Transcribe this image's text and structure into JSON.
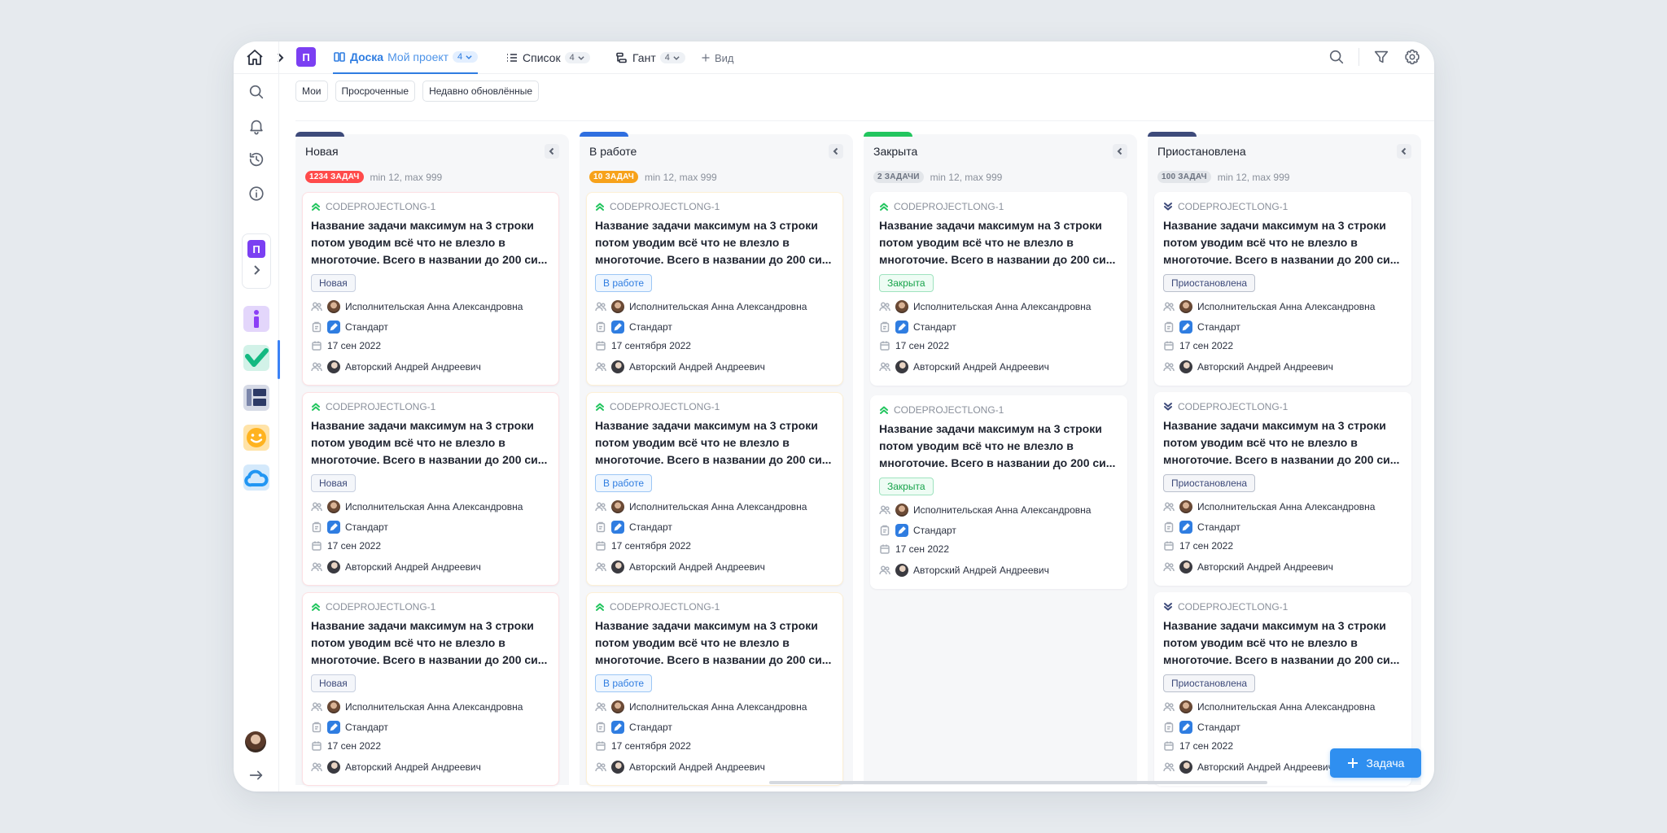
{
  "colors": {
    "accent": "#2f7de1",
    "project_badge": "#7b3ff2",
    "new_badge": "#ff4b4b",
    "in_progress_badge": "#f7a21b",
    "closed_accent": "#22c55e",
    "paused_accent": "#3d4a7a"
  },
  "topbar": {
    "project_letter": "П",
    "tabs": [
      {
        "name": "Доска",
        "project": "Мой проект",
        "count": "4",
        "icon": "board-icon"
      },
      {
        "name": "Список",
        "count": "4",
        "icon": "list-icon"
      },
      {
        "name": "Гант",
        "count": "4",
        "icon": "gantt-icon"
      }
    ],
    "add_view_label": "Вид"
  },
  "filters": [
    "Мои",
    "Просроченные",
    "Недавно обновлённые"
  ],
  "sidebar": {
    "project_letter": "П",
    "icons": [
      "home-icon",
      "search-icon",
      "bell-icon",
      "history-icon",
      "info-icon"
    ]
  },
  "columns": [
    {
      "title": "Новая",
      "badge": "1234 ЗАДАЧ",
      "badge_color": "#ff4b4b",
      "limits": "min 12, max 999",
      "accent": "#3d4a7a",
      "cards": [
        {
          "code": "CODEPROJECTLONG-1",
          "priority": "up",
          "title": "Название задачи максимум на 3 строки потом уводим всё что не влезло в многоточие. Всего в названии до 200 си...",
          "status": "Новая",
          "assignee": "Исполнительская Анна Александровна",
          "type": "Стандарт",
          "date": "17 сен 2022",
          "author": "Авторский Андрей Андреевич"
        },
        {
          "code": "CODEPROJECTLONG-1",
          "priority": "up",
          "title": "Название задачи максимум на 3 строки потом уводим всё что не влезло в многоточие. Всего в названии до 200 си...",
          "status": "Новая",
          "assignee": "Исполнительская Анна Александровна",
          "type": "Стандарт",
          "date": "17 сен 2022",
          "author": "Авторский Андрей Андреевич"
        },
        {
          "code": "CODEPROJECTLONG-1",
          "priority": "up",
          "title": "Название задачи максимум на 3 строки потом уводим всё что не влезло в многоточие. Всего в названии до 200 си...",
          "status": "Новая",
          "assignee": "Исполнительская Анна Александровна",
          "type": "Стандарт",
          "date": "17 сен 2022",
          "author": "Авторский Андрей Андреевич"
        }
      ]
    },
    {
      "title": "В работе",
      "badge": "10 ЗАДАЧ",
      "badge_color": "#f7a21b",
      "limits": "min 12, max 999",
      "accent": "#2f6fe0",
      "cards": [
        {
          "code": "CODEPROJECTLONG-1",
          "priority": "up",
          "title": "Название задачи максимум на 3 строки потом уводим всё что не влезло в многоточие. Всего в названии до 200 си...",
          "status": "В работе",
          "assignee": "Исполнительская Анна Александровна",
          "type": "Стандарт",
          "date": "17 сентября 2022",
          "author": "Авторский Андрей Андреевич"
        },
        {
          "code": "CODEPROJECTLONG-1",
          "priority": "up",
          "title": "Название задачи максимум на 3 строки потом уводим всё что не влезло в многоточие. Всего в названии до 200 си...",
          "status": "В работе",
          "assignee": "Исполнительская Анна Александровна",
          "type": "Стандарт",
          "date": "17 сентября 2022",
          "author": "Авторский Андрей Андреевич"
        },
        {
          "code": "CODEPROJECTLONG-1",
          "priority": "up",
          "title": "Название задачи максимум на 3 строки потом уводим всё что не влезло в многоточие. Всего в названии до 200 си...",
          "status": "В работе",
          "assignee": "Исполнительская Анна Александровна",
          "type": "Стандарт",
          "date": "17 сентября 2022",
          "author": "Авторский Андрей Андреевич"
        }
      ]
    },
    {
      "title": "Закрыта",
      "badge": "2 ЗАДАЧИ",
      "badge_color": "#e3e6ea",
      "limits": "min 12, max 999",
      "accent": "#22c55e",
      "cards": [
        {
          "code": "CODEPROJECTLONG-1",
          "priority": "up",
          "title": "Название задачи максимум на 3 строки потом уводим всё что не влезло в многоточие. Всего в названии до 200 си...",
          "status": "Закрыта",
          "assignee": "Исполнительская Анна Александровна",
          "type": "Стандарт",
          "date": "17 сен 2022",
          "author": "Авторский Андрей Андреевич"
        },
        {
          "code": "CODEPROJECTLONG-1",
          "priority": "up",
          "title": "Название задачи максимум на 3 строки потом уводим всё что не влезло в многоточие. Всего в названии до 200 си...",
          "status": "Закрыта",
          "assignee": "Исполнительская Анна Александровна",
          "type": "Стандарт",
          "date": "17 сен 2022",
          "author": "Авторский Андрей Андреевич"
        }
      ]
    },
    {
      "title": "Приостановлена",
      "badge": "100 ЗАДАЧ",
      "badge_color": "#e3e6ea",
      "limits": "min 12, max 999",
      "accent": "#3d4a7a",
      "cards": [
        {
          "code": "CODEPROJECTLONG-1",
          "priority": "down",
          "title": "Название задачи максимум на 3 строки потом уводим всё что не влезло в многоточие. Всего в названии до 200 си...",
          "status": "Приостановлена",
          "assignee": "Исполнительская Анна Александровна",
          "type": "Стандарт",
          "date": "17 сен 2022",
          "author": "Авторский Андрей Андреевич"
        },
        {
          "code": "CODEPROJECTLONG-1",
          "priority": "down",
          "title": "Название задачи максимум на 3 строки потом уводим всё что не влезло в многоточие. Всего в названии до 200 си...",
          "status": "Приостановлена",
          "assignee": "Исполнительская Анна Александровна",
          "type": "Стандарт",
          "date": "17 сен 2022",
          "author": "Авторский Андрей Андреевич"
        },
        {
          "code": "CODEPROJECTLONG-1",
          "priority": "down",
          "title": "Название задачи максимум на 3 строки потом уводим всё что не влезло в многоточие. Всего в названии до 200 си...",
          "status": "Приостановлена",
          "assignee": "Исполнительская Анна Александровна",
          "type": "Стандарт",
          "date": "17 сен 2022",
          "author": "Авторский Андрей Андреевич"
        }
      ]
    }
  ],
  "add_task_label": "Задача"
}
